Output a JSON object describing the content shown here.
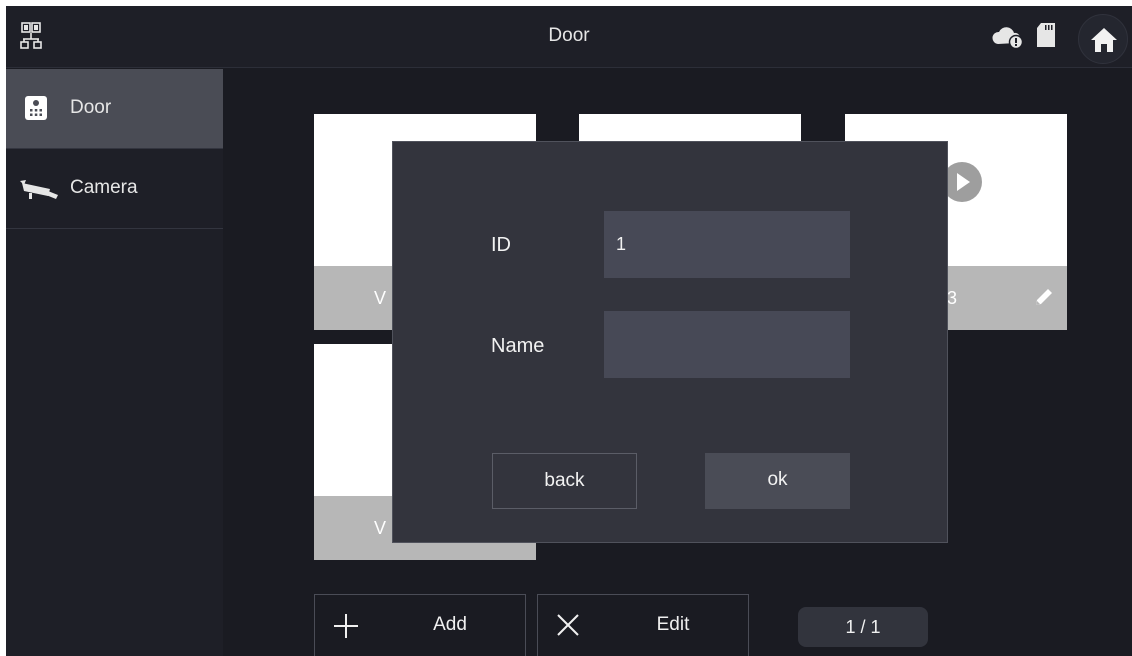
{
  "header": {
    "title": "Door"
  },
  "sidebar": {
    "items": [
      {
        "label": "Door",
        "icon": "door-station-icon",
        "active": true
      },
      {
        "label": "Camera",
        "icon": "camera-icon",
        "active": false
      }
    ]
  },
  "tiles": [
    {
      "name": "V",
      "has_play": false,
      "has_edit": false
    },
    {
      "name": "",
      "has_play": false,
      "has_edit": false
    },
    {
      "name": "3",
      "has_play": true,
      "has_edit": true
    },
    {
      "name": "V",
      "has_play": false,
      "has_edit": false
    }
  ],
  "toolbar": {
    "add_label": "Add",
    "edit_label": "Edit",
    "page": "1 / 1"
  },
  "dialog": {
    "id_label": "ID",
    "id_value": "1",
    "name_label": "Name",
    "name_value": "",
    "back_label": "back",
    "ok_label": "ok"
  },
  "colors": {
    "background": "#1a1b22",
    "sidebar_active": "#4a4c55",
    "dialog": "#33343d",
    "input": "#474956",
    "tile_bar": "#b7b7b7"
  },
  "icons": [
    "network-icon",
    "cloud-icon",
    "sd-card-icon",
    "home-icon",
    "play-icon",
    "pencil-icon",
    "plus-icon",
    "close-icon"
  ]
}
